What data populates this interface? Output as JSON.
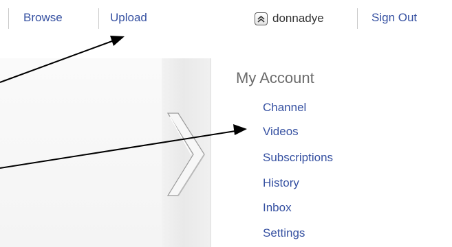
{
  "nav": {
    "browse_label": "Browse",
    "upload_label": "Upload",
    "username": "donnadye",
    "sign_out_label": "Sign Out"
  },
  "my_account": {
    "title": "My Account",
    "items": [
      {
        "label": "Channel"
      },
      {
        "label": "Videos"
      },
      {
        "label": "Subscriptions"
      },
      {
        "label": "History"
      },
      {
        "label": "Inbox"
      },
      {
        "label": "Settings"
      }
    ]
  },
  "icons": {
    "user_menu": "double-chevron-up-icon",
    "expander": "double-chevron-right-icon"
  },
  "colors": {
    "link": "#3550a1",
    "heading": "#6b6b6b",
    "annotation_arrow": "#000000"
  }
}
